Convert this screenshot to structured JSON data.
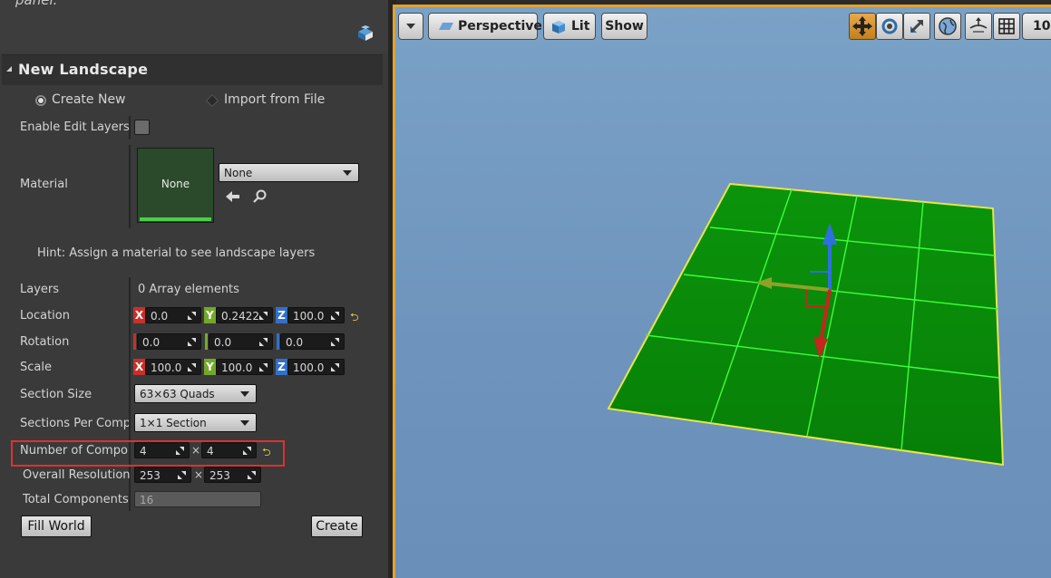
{
  "panel": {
    "cut_off_title": "panel.",
    "section_title": "New Landscape",
    "radio_create": "Create New",
    "radio_import": "Import from File",
    "enable_edit_layers_label": "Enable Edit Layers",
    "material_label": "Material",
    "material_thumb_text": "None",
    "material_combo_value": "None",
    "hint": "Hint: Assign a material to see landscape layers",
    "layers_label": "Layers",
    "layers_value": "0 Array elements",
    "location_label": "Location",
    "location": {
      "x": "0.0",
      "y": "0.2422",
      "z": "100.0"
    },
    "rotation_label": "Rotation",
    "rotation": {
      "x": "0.0",
      "y": "0.0",
      "z": "0.0"
    },
    "scale_label": "Scale",
    "scale": {
      "x": "100.0",
      "y": "100.0",
      "z": "100.0"
    },
    "axis_x": "X",
    "axis_y": "Y",
    "axis_z": "Z",
    "section_size_label": "Section Size",
    "section_size_value": "63×63 Quads",
    "sections_per_component_label": "Sections Per Compon",
    "sections_per_component_value": "1×1 Section",
    "number_of_components_label": "Number of Compone",
    "number_of_components": {
      "x": "4",
      "y": "4"
    },
    "overall_resolution_label": "Overall Resolution",
    "overall_resolution": {
      "x": "253",
      "y": "253"
    },
    "total_components_label": "Total Components",
    "total_components_value": "16",
    "times": "×",
    "fill_world_button": "Fill World",
    "create_button": "Create"
  },
  "viewport": {
    "perspective_button": "Perspective",
    "lit_button": "Lit",
    "show_button": "Show",
    "grid_snap_value": "10"
  },
  "colors": {
    "highlight_box": "#e03030",
    "axis_x": "#c8302a",
    "axis_y": "#74a82a",
    "axis_z": "#3270cc",
    "landscape_green": "#0a8c0a",
    "viewport_border": "#e0a330"
  }
}
